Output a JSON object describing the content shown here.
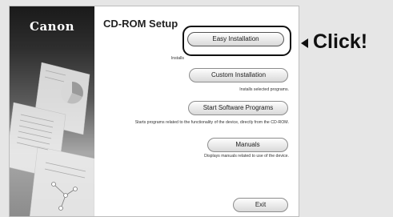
{
  "window": {
    "brand": "Canon",
    "title": "CD-ROM Setup"
  },
  "buttons": {
    "easy_installation": "Easy Installation",
    "custom_installation": "Custom Installation",
    "start_software_programs": "Start Software Programs",
    "manuals": "Manuals",
    "exit": "Exit"
  },
  "descriptions": {
    "easy_installation": "Installs",
    "custom_installation": "Installs selected programs.",
    "start_software_programs": "Starts programs related to the functionality of the device, directly from the CD-ROM.",
    "manuals": "Displays manuals related to use of the device."
  },
  "callout": {
    "label": "Click!"
  },
  "colors": {
    "page_background": "#e6e6e6",
    "window_background": "#ffffff",
    "callout": "#111111"
  }
}
